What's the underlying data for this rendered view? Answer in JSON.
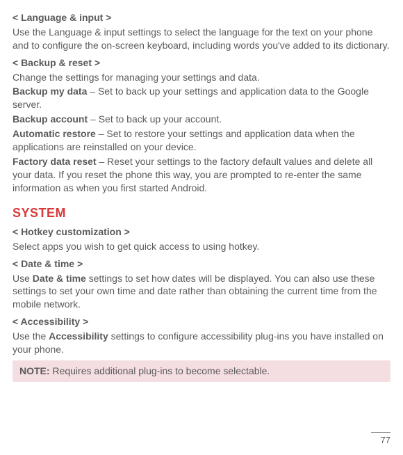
{
  "sections": {
    "language_input": {
      "heading": "< Language & input >",
      "body": "Use the Language & input settings to select the language for the text on your phone and to configure the on-screen keyboard, including words you've added to its dictionary."
    },
    "backup_reset": {
      "heading": "< Backup & reset >",
      "intro": "Change the settings for managing your settings and data.",
      "items": [
        {
          "label": "Backup my data",
          "desc": " – Set to back up your settings and application data to the Google server."
        },
        {
          "label": "Backup account",
          "desc": " – Set to back up your account."
        },
        {
          "label": "Automatic restore",
          "desc": " – Set to restore your settings and application data when the applications are reinstalled on your device."
        },
        {
          "label": "Factory data reset",
          "desc": " – Reset your settings to the factory default values and delete all your data. If you reset the phone this way, you are prompted to re-enter the same information as when you first started Android."
        }
      ]
    },
    "system_heading": "SYSTEM",
    "hotkey": {
      "heading": "< Hotkey customization >",
      "body": "Select apps you wish to get quick access to using hotkey."
    },
    "date_time": {
      "heading": "< Date & time >",
      "prefix": "Use ",
      "bold": "Date & time",
      "suffix": " settings to set how dates will be displayed. You can also use these settings to set your own time and date rather than obtaining the current time from the mobile network."
    },
    "accessibility": {
      "heading": "< Accessibility >",
      "prefix": "Use the ",
      "bold": "Accessibility",
      "suffix": " settings to configure accessibility plug-ins you have installed on your phone."
    },
    "note": {
      "label": "NOTE:",
      "text": " Requires additional plug-ins to become selectable."
    }
  },
  "page_number": "77"
}
